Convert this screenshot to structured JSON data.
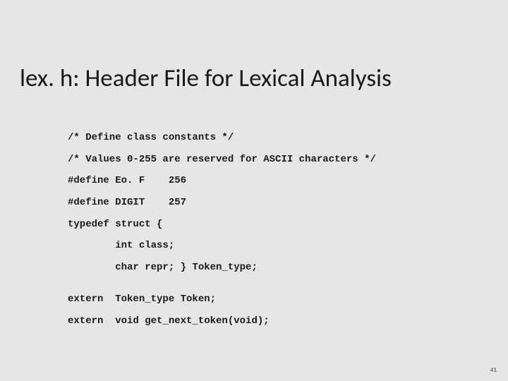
{
  "title": "lex. h: Header File for Lexical Analysis",
  "code": {
    "l1": "/* Define class constants */",
    "l2": "/* Values 0-255 are reserved for ASCII characters */",
    "l3": "#define Eo. F    256",
    "l4": "#define DIGIT    257",
    "l5": "typedef struct {",
    "l6": "        int class;",
    "l7": "        char repr; } Token_type;",
    "l8": "extern  Token_type Token;",
    "l9": "extern  void get_next_token(void);"
  },
  "page": "41"
}
